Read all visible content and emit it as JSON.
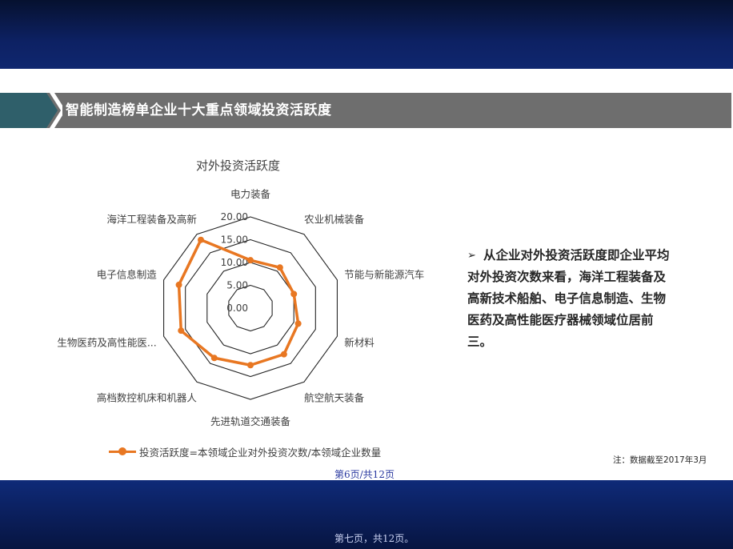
{
  "slide": {
    "title": "智能制造榜单企业十大重点领域投资活跃度",
    "bullet_marker": "➢",
    "bullet_text": "从企业对外投资活跃度即企业平均对外投资次数来看，海洋工程装备及高新技术船舶、电子信息制造、生物医药及高性能医疗器械领域位居前三。",
    "note": "注：数据截至2017年3月",
    "page_indicator": "第6页/共12页",
    "footer": "第七页，共12页。"
  },
  "colors": {
    "series": "#e87722",
    "grid": "#262626",
    "title_band": "#6e6e6e",
    "chevron": "#2f5f6a"
  },
  "chart_data": {
    "type": "radar",
    "title": "对外投资活跃度",
    "categories": [
      "电力装备",
      "农业机械装备",
      "节能与新能源汽车",
      "新材料",
      "航空航天装备",
      "先进轨道交通装备",
      "高档数控机床和机器人",
      "生物医药及高性能医...",
      "电子信息制造",
      "海洋工程装备及高新"
    ],
    "tick_labels": [
      "0.00",
      "5.00",
      "10.00",
      "15.00",
      "20.00"
    ],
    "rlim": [
      0,
      20
    ],
    "series": [
      {
        "name": "投资活跃度=本领域企业对外投资次数/本领域企业数量",
        "values": [
          10.5,
          11.0,
          10.0,
          11.0,
          12.5,
          12.5,
          13.5,
          16.0,
          16.5,
          18.5
        ]
      }
    ],
    "legend_position": "bottom",
    "grid": true
  }
}
